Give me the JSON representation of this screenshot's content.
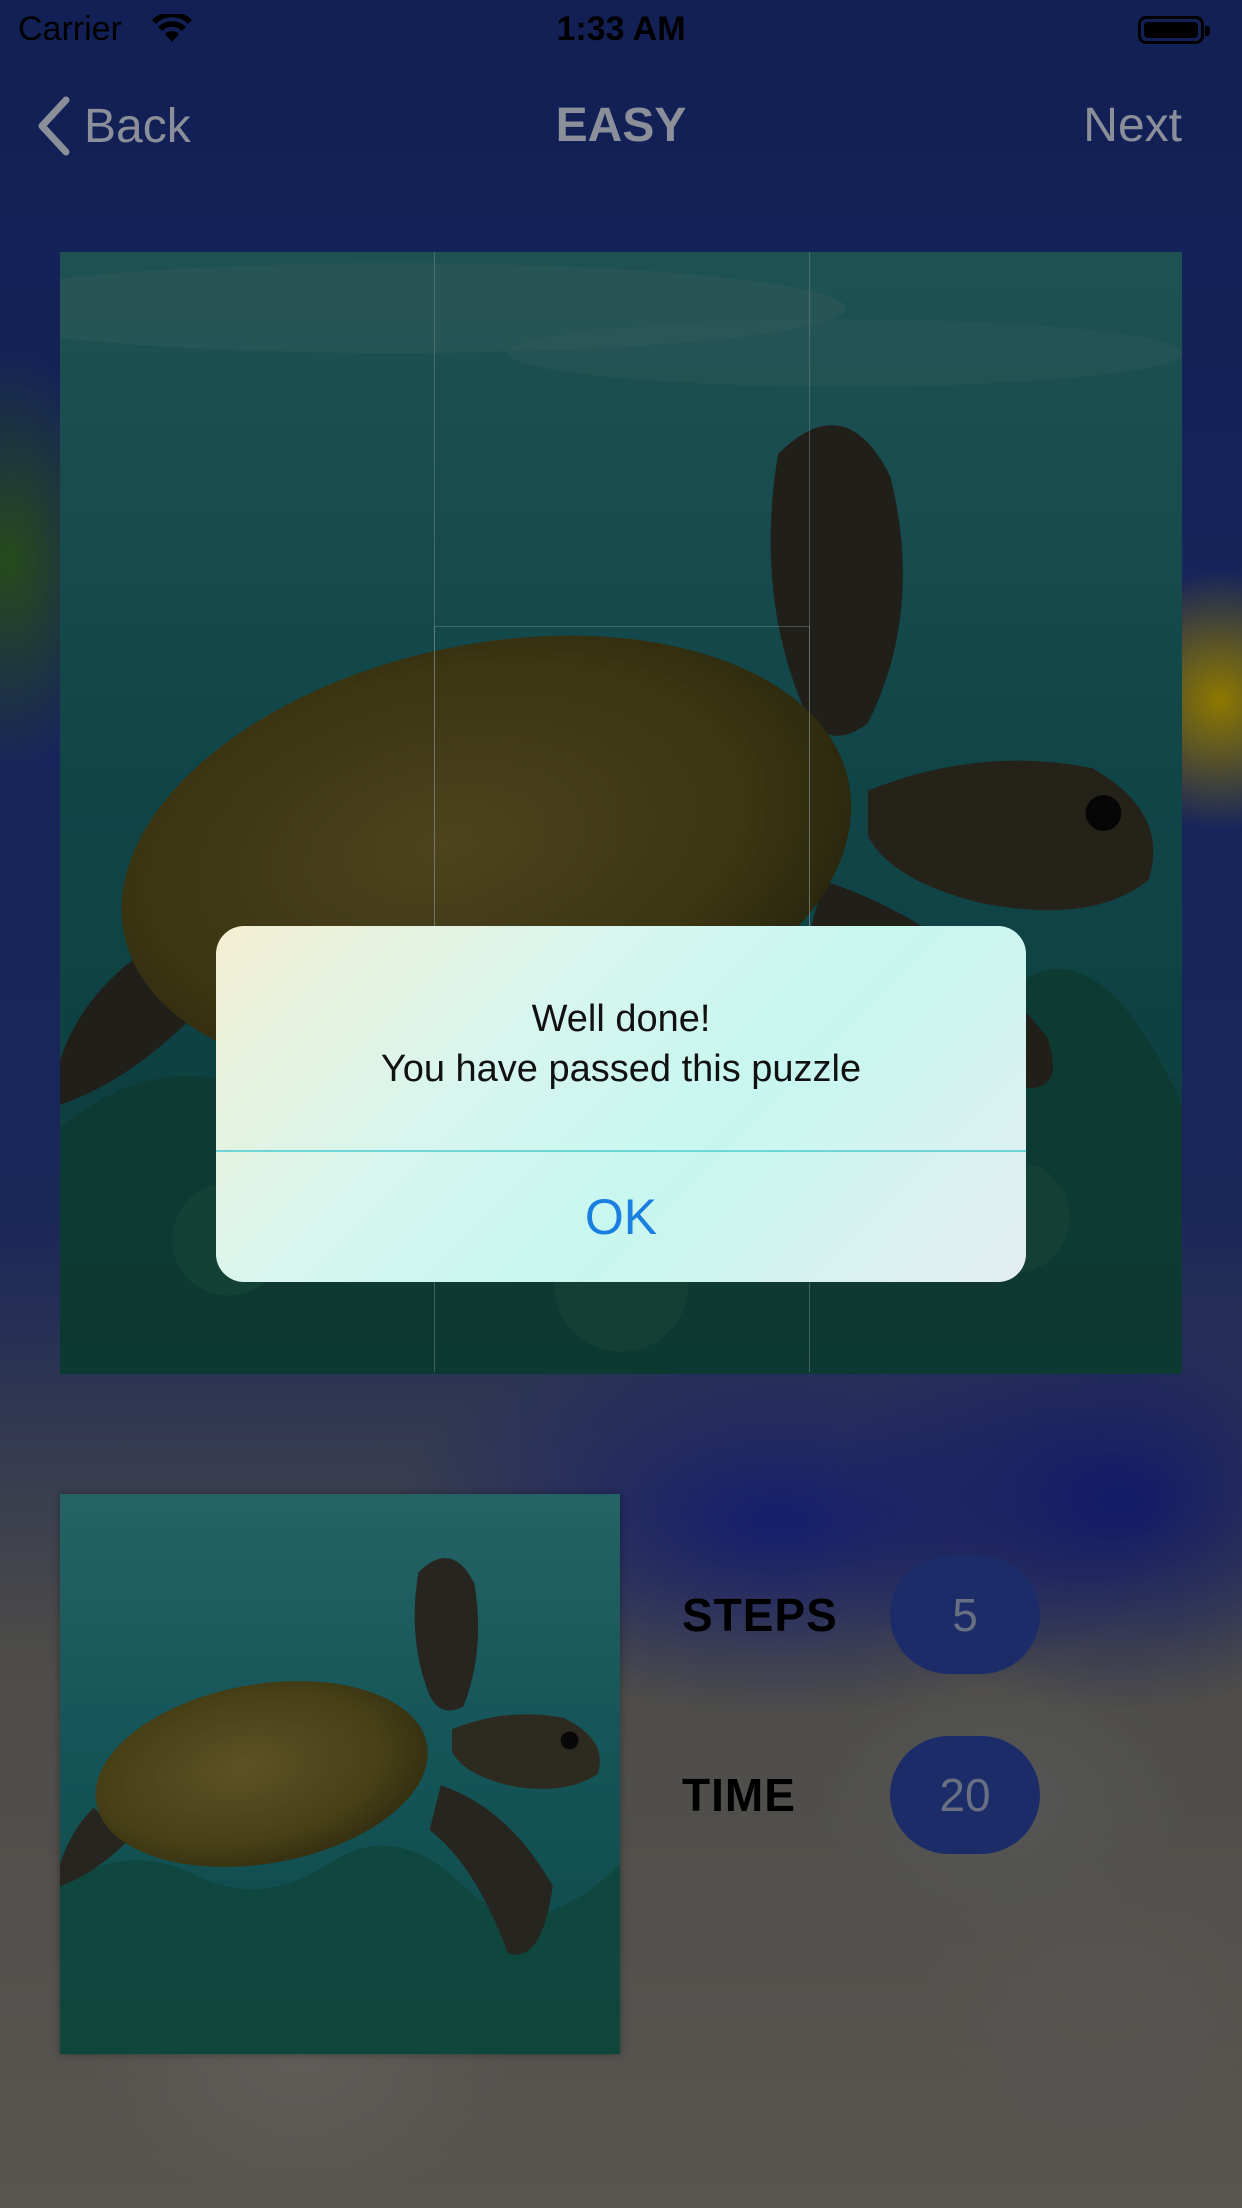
{
  "status_bar": {
    "carrier": "Carrier",
    "time": "1:33 AM"
  },
  "nav": {
    "back_label": "Back",
    "title": "EASY",
    "next_label": "Next"
  },
  "stats": {
    "steps_label": "STEPS",
    "steps_value": "5",
    "time_label": "TIME",
    "time_value": "20"
  },
  "alert": {
    "title": "Well done!",
    "message": "You have passed this puzzle",
    "ok_label": "OK"
  },
  "colors": {
    "accent": "#1a7fe0",
    "badge": "#2c47a8",
    "nav_text": "#8a8f99"
  }
}
